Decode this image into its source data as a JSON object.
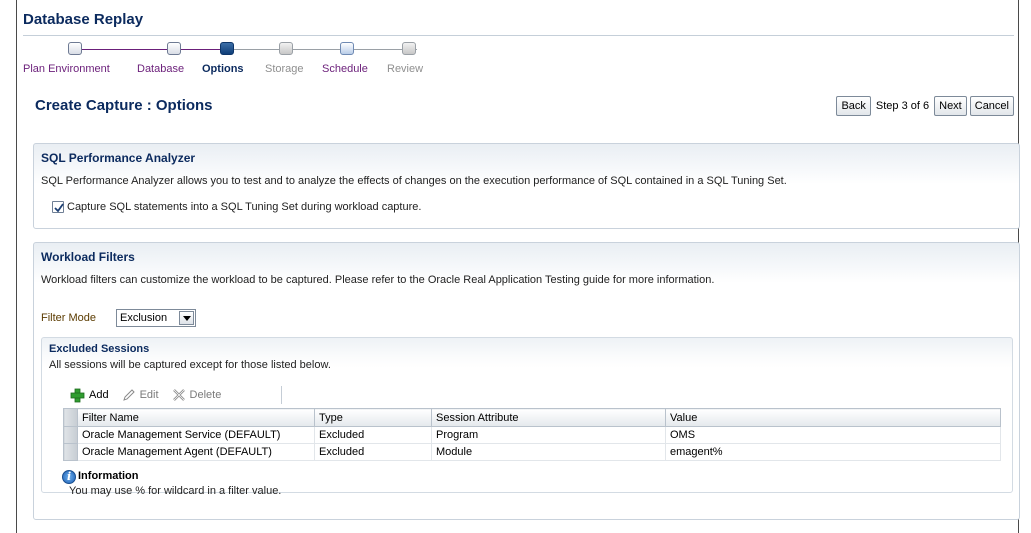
{
  "app": {
    "title": "Database Replay"
  },
  "train": {
    "steps": [
      {
        "label": "Plan Environment",
        "state": "done"
      },
      {
        "label": "Database",
        "state": "done"
      },
      {
        "label": "Options",
        "state": "current"
      },
      {
        "label": "Storage",
        "state": "future"
      },
      {
        "label": "Schedule",
        "state": "link"
      },
      {
        "label": "Review",
        "state": "future"
      }
    ]
  },
  "page": {
    "title": "Create Capture : Options"
  },
  "nav": {
    "back": "Back",
    "step_info": "Step 3 of 6",
    "next": "Next",
    "cancel": "Cancel"
  },
  "spa": {
    "title": "SQL Performance Analyzer",
    "description": "SQL Performance Analyzer allows you to test and to analyze the effects of changes on the execution performance of SQL contained in a SQL Tuning Set.",
    "checkbox_label": "Capture SQL statements into a SQL Tuning Set during workload capture.",
    "checkbox_checked": true
  },
  "filters": {
    "title": "Workload Filters",
    "description": "Workload filters can customize the workload to be captured. Please refer to the Oracle Real Application Testing guide for more information.",
    "mode_label": "Filter Mode",
    "mode_value": "Exclusion",
    "excluded": {
      "title": "Excluded Sessions",
      "description": "All sessions will be captured except for those listed below.",
      "toolbar": {
        "add": "Add",
        "edit": "Edit",
        "delete": "Delete"
      },
      "columns": [
        "Filter Name",
        "Type",
        "Session Attribute",
        "Value"
      ],
      "rows": [
        [
          "Oracle Management Service (DEFAULT)",
          "Excluded",
          "Program",
          "OMS"
        ],
        [
          "Oracle Management Agent (DEFAULT)",
          "Excluded",
          "Module",
          "emagent%"
        ]
      ]
    },
    "info": {
      "title": "Information",
      "text": "You may use % for wildcard in a filter value."
    }
  }
}
